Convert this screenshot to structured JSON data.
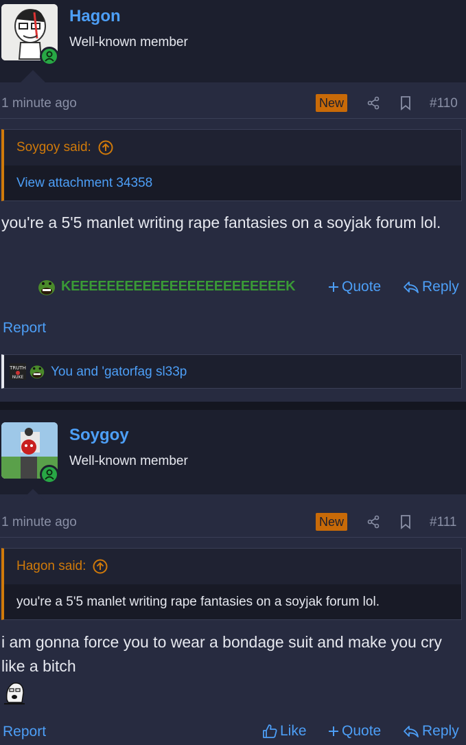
{
  "posts": [
    {
      "username": "Hagon",
      "user_title": "Well-known member",
      "time": "1 minute ago",
      "badge": "New",
      "post_number": "#110",
      "quote": {
        "author": "Soygoy said:",
        "content": "View attachment 34358"
      },
      "message": "you're a 5'5 manlet writing rape fantasies on a soyjak forum lol.",
      "reaction_label": "KEEEEEEEEEEEEEEEEEEEEEEEEK",
      "actions": {
        "quote": "Quote",
        "reply": "Reply",
        "report": "Report"
      },
      "reactions_summary": "You and 'gatorfag sl33p"
    },
    {
      "username": "Soygoy",
      "user_title": "Well-known member",
      "time": "1 minute ago",
      "badge": "New",
      "post_number": "#111",
      "quote": {
        "author": "Hagon said:",
        "content": "you're a 5'5 manlet writing rape fantasies on a soyjak forum lol."
      },
      "message": "i am gonna force you to wear a bondage suit and make you cry like a bitch",
      "actions": {
        "like": "Like",
        "quote": "Quote",
        "reply": "Reply",
        "report": "Report"
      }
    }
  ],
  "colors": {
    "background": "#272b40",
    "header": "#1c1f2e",
    "link": "#4d9ff7",
    "accent_orange": "#d07a0a",
    "online": "#28a745",
    "reaction_green": "#3a9a36"
  },
  "icons": [
    "user-icon",
    "share-icon",
    "bookmark-icon",
    "arrow-up-circle-icon",
    "plus-icon",
    "reply-icon",
    "thumbs-up-icon",
    "kek-emoji-icon",
    "truth-nuke-emoji-icon"
  ]
}
